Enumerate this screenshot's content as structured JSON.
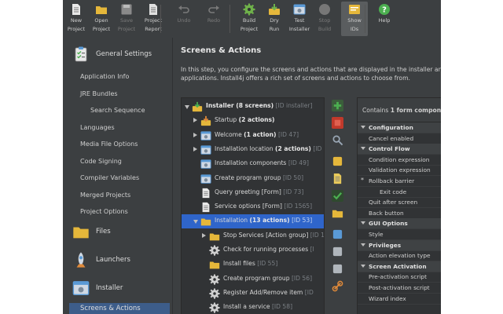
{
  "toolbar": {
    "buttons": [
      {
        "label": "New\nProject",
        "icon": "new-project-icon",
        "color": "#e8e8e8",
        "enabled": true
      },
      {
        "label": "Open\nProject",
        "icon": "open-folder-icon",
        "color": "#e5b73b",
        "enabled": true
      },
      {
        "label": "Save\nProject",
        "icon": "save-icon",
        "color": "#8a8a8a",
        "enabled": false
      },
      {
        "label": "Project\nReport",
        "icon": "report-icon",
        "color": "#e0e0e0",
        "enabled": true
      },
      {
        "label": "Undo",
        "icon": "undo-icon",
        "color": "#7a7a7a",
        "enabled": false
      },
      {
        "label": "Redo",
        "icon": "redo-icon",
        "color": "#7a7a7a",
        "enabled": false
      },
      {
        "label": "Build\nProject",
        "icon": "build-gear-icon",
        "color": "#6fb24a",
        "enabled": true
      },
      {
        "label": "Dry\nRun",
        "icon": "dry-run-icon",
        "color": "#6fb24a",
        "enabled": true
      },
      {
        "label": "Test\nInstaller",
        "icon": "test-installer-icon",
        "color": "#5a9ad6",
        "enabled": true
      },
      {
        "label": "Stop\nBuild",
        "icon": "stop-icon",
        "color": "#777777",
        "enabled": false
      },
      {
        "label": "Show\nIDs",
        "icon": "show-ids-icon",
        "color": "#e5b73b",
        "enabled": true
      },
      {
        "label": "Help",
        "icon": "help-icon",
        "color": "#4caf50",
        "enabled": true
      }
    ]
  },
  "sidebar": {
    "general": {
      "label": "General Settings",
      "icon": "clipboard-icon"
    },
    "general_items": [
      {
        "label": "Application Info",
        "sub": false
      },
      {
        "label": "JRE Bundles",
        "sub": false
      },
      {
        "label": "Search Sequence",
        "sub": true
      },
      {
        "label": "Languages",
        "sub": false
      },
      {
        "label": "Media File Options",
        "sub": false
      },
      {
        "label": "Code Signing",
        "sub": false
      },
      {
        "label": "Compiler Variables",
        "sub": false
      },
      {
        "label": "Merged Projects",
        "sub": false
      },
      {
        "label": "Project Options",
        "sub": false
      }
    ],
    "sections": [
      {
        "label": "Files",
        "icon": "folder-icon"
      },
      {
        "label": "Launchers",
        "icon": "rocket-icon"
      },
      {
        "label": "Installer",
        "icon": "installer-window-icon"
      }
    ],
    "selected_item": "Screens & Actions"
  },
  "main": {
    "title": "Screens & Actions",
    "desc_line1": "In this step, you configure the screens and actions that are displayed in the installer and",
    "desc_line2": "applications. Install4j offers a rich set of screens and actions to choose from."
  },
  "tree": [
    {
      "level": 0,
      "tw": "down",
      "icon": "installer-icon",
      "bold": "Installer (8 screens)",
      "text": "",
      "id": "[ID installer]",
      "selected": false
    },
    {
      "level": 1,
      "tw": "right",
      "icon": "startup-icon",
      "bold": "",
      "text": "Startup ",
      "bold2": "(2 actions)",
      "id": "",
      "selected": false
    },
    {
      "level": 1,
      "tw": "right",
      "icon": "screen-icon",
      "bold": "",
      "text": "Welcome ",
      "bold2": "(1 action)",
      "id": "[ID 47]",
      "selected": false
    },
    {
      "level": 1,
      "tw": "right",
      "icon": "screen-icon",
      "bold": "",
      "text": "Installation location ",
      "bold2": "(2 actions)",
      "id": "[ID 48]",
      "selected": false
    },
    {
      "level": 1,
      "tw": "",
      "icon": "screen-icon",
      "bold": "",
      "text": "Installation components ",
      "bold2": "",
      "id": "[ID 49]",
      "selected": false
    },
    {
      "level": 1,
      "tw": "",
      "icon": "screen-icon",
      "bold": "",
      "text": "Create program group ",
      "bold2": "",
      "id": "[ID 50]",
      "selected": false
    },
    {
      "level": 1,
      "tw": "",
      "icon": "form-icon",
      "bold": "",
      "text": "Query greeting [Form] ",
      "bold2": "",
      "id": "[ID 73]",
      "selected": false
    },
    {
      "level": 1,
      "tw": "",
      "icon": "form-icon",
      "bold": "",
      "text": "Service options [Form] ",
      "bold2": "",
      "id": "[ID 1565]",
      "selected": false
    },
    {
      "level": 1,
      "tw": "down",
      "icon": "installation-folder-icon",
      "bold": "",
      "text": "Installation ",
      "bold2": "(13 actions)",
      "id": "[ID 53]",
      "selected": true
    },
    {
      "level": 2,
      "tw": "right",
      "icon": "folder-icon",
      "bold": "",
      "text": "Stop Services [Action group] ",
      "bold2": "",
      "id": "[ID 1",
      "selected": false
    },
    {
      "level": 2,
      "tw": "",
      "icon": "gear-icon",
      "bold": "",
      "text": "Check for running processes ",
      "bold2": "",
      "id": "[I",
      "selected": false
    },
    {
      "level": 2,
      "tw": "",
      "icon": "folder-icon",
      "bold": "",
      "text": "Install files ",
      "bold2": "",
      "id": "[ID 55]",
      "selected": false
    },
    {
      "level": 2,
      "tw": "",
      "icon": "gear-icon",
      "bold": "",
      "text": "Create program group ",
      "bold2": "",
      "id": "[ID 56]",
      "selected": false
    },
    {
      "level": 2,
      "tw": "",
      "icon": "gear-icon",
      "bold": "",
      "text": "Register Add/Remove item ",
      "bold2": "",
      "id": "[ID",
      "selected": false
    },
    {
      "level": 2,
      "tw": "",
      "icon": "gear-icon",
      "bold": "",
      "text": "Install a service ",
      "bold2": "",
      "id": "[ID 58]",
      "selected": false
    }
  ],
  "action_bar": [
    {
      "name": "add-icon",
      "color": "#4caf50"
    },
    {
      "name": "delete-icon",
      "color": "#c0392b"
    },
    {
      "name": "search-icon",
      "color": "#9aa7b5"
    },
    {
      "name": "palette-icon",
      "color": "#e5b73b"
    },
    {
      "name": "note-icon",
      "color": "#e8c95a"
    },
    {
      "name": "check-icon",
      "color": "#4caf50"
    },
    {
      "name": "folder-icon",
      "color": "#e5b73b"
    },
    {
      "name": "move-icon",
      "color": "#5a9ad6"
    },
    {
      "name": "copy-icon",
      "color": "#b0b6bc"
    },
    {
      "name": "paste-icon",
      "color": "#b0b6bc"
    },
    {
      "name": "link-icon",
      "color": "#e08a3a"
    }
  ],
  "props": {
    "header_prefix": "Contains ",
    "header_bold": "1 form compone",
    "rows": [
      {
        "label": "Configuration",
        "type": "cat"
      },
      {
        "label": "Cancel enabled",
        "type": "prop"
      },
      {
        "label": "Control Flow",
        "type": "cat"
      },
      {
        "label": "Condition expression",
        "type": "prop"
      },
      {
        "label": "Validation expression",
        "type": "prop"
      },
      {
        "label": "Rollback barrier",
        "type": "star"
      },
      {
        "label": "Exit code",
        "type": "indent"
      },
      {
        "label": "Quit after screen",
        "type": "prop"
      },
      {
        "label": "Back button",
        "type": "prop"
      },
      {
        "label": "GUI Options",
        "type": "cat"
      },
      {
        "label": "Style",
        "type": "prop"
      },
      {
        "label": "Privileges",
        "type": "cat"
      },
      {
        "label": "Action elevation type",
        "type": "prop"
      },
      {
        "label": "Screen Activation",
        "type": "cat"
      },
      {
        "label": "Pre-activation script",
        "type": "prop"
      },
      {
        "label": "Post-activation script",
        "type": "prop"
      },
      {
        "label": "Wizard index",
        "type": "prop"
      }
    ]
  }
}
